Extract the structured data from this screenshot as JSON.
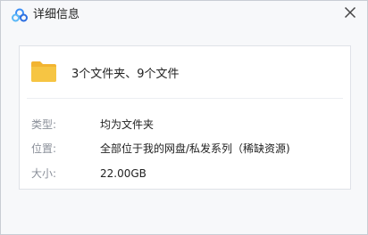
{
  "dialog": {
    "title": "详细信息",
    "close_icon": "close-icon",
    "logo_icon": "baidu-netdisk-logo-icon"
  },
  "summary": {
    "icon": "folder-icon",
    "text": "3个文件夹、9个文件"
  },
  "properties": [
    {
      "label": "类型:",
      "value": "均为文件夹"
    },
    {
      "label": "位置:",
      "value": "全部位于我的网盘/私发系列（稀缺资源)"
    },
    {
      "label": "大小:",
      "value": "22.00GB"
    }
  ],
  "colors": {
    "background": "#f7f8fa",
    "card": "#ffffff",
    "border": "#dfe2e8",
    "label": "#8a8f99",
    "text": "#222222",
    "folder": "#f6c543",
    "logo_blue": "#3a8ef6"
  }
}
